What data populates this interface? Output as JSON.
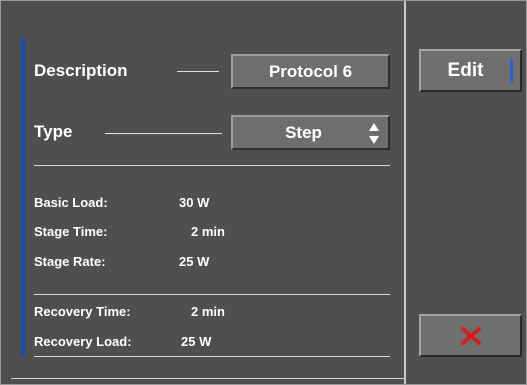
{
  "form": {
    "description_label": "Description",
    "description_value": "Protocol 6",
    "type_label": "Type",
    "type_value": "Step",
    "basic_load_label": "Basic Load:",
    "basic_load_value": "30 W",
    "stage_time_label": "Stage Time:",
    "stage_time_value": "2 min",
    "stage_rate_label": "Stage Rate:",
    "stage_rate_value": "25 W",
    "recovery_time_label": "Recovery Time:",
    "recovery_time_value": "2 min",
    "recovery_load_label": "Recovery Load:",
    "recovery_load_value": "25 W"
  },
  "actions": {
    "edit_label": "Edit",
    "cancel_icon": "close-icon"
  },
  "colors": {
    "background": "#4f4f4f",
    "accent_blue": "#1a4fa8",
    "cancel_red": "#d21f1f"
  }
}
